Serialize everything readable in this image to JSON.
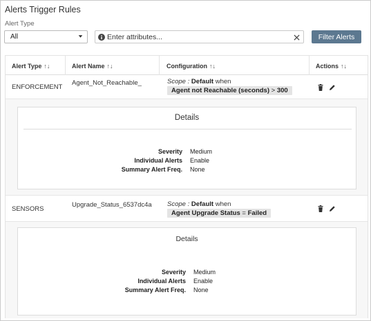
{
  "page": {
    "title": "Alerts Trigger Rules"
  },
  "filter": {
    "alert_type_label": "Alert Type",
    "alert_type_selected": "All",
    "search_placeholder": "Enter attributes...",
    "filter_button": "Filter Alerts"
  },
  "table": {
    "columns": [
      {
        "label": "Alert Type",
        "sort_icon": "↑↓"
      },
      {
        "label": "Alert Name",
        "sort_icon": "↑↓"
      },
      {
        "label": "Configuration",
        "sort_icon": "↑↓"
      },
      {
        "label": "Actions",
        "sort_icon": "↑↓"
      }
    ],
    "rows": [
      {
        "alert_type": "ENFORCEMENT",
        "alert_name": "Agent_Not_Reachable_",
        "scope_label": "Scope :",
        "scope_value": "Default",
        "when": "when",
        "condition_field": "Agent not Reachable (seconds)",
        "condition_op": ">",
        "condition_value": "300",
        "actions": [
          "trash-icon",
          "edit-icon"
        ],
        "details": {
          "title": "Details",
          "items": [
            {
              "key": "Severity",
              "value": "Medium"
            },
            {
              "key": "Individual Alerts",
              "value": "Enable"
            },
            {
              "key": "Summary Alert Freq.",
              "value": "None"
            }
          ]
        }
      },
      {
        "alert_type": "SENSORS",
        "alert_name": "Upgrade_Status_6537dc4a",
        "scope_label": "Scope :",
        "scope_value": "Default",
        "when": "when",
        "condition_field": "Agent Upgrade Status",
        "condition_op": "=",
        "condition_value": "Failed",
        "actions": [
          "trash-icon",
          "edit-icon"
        ],
        "details": {
          "title": "Details",
          "items": [
            {
              "key": "Severity",
              "value": "Medium"
            },
            {
              "key": "Individual Alerts",
              "value": "Enable"
            },
            {
              "key": "Summary Alert Freq.",
              "value": "None"
            }
          ]
        }
      }
    ]
  },
  "colors": {
    "filter_button": "#5c7890",
    "chip": "#e4e4e4",
    "details_bg": "#f7f7f7"
  }
}
